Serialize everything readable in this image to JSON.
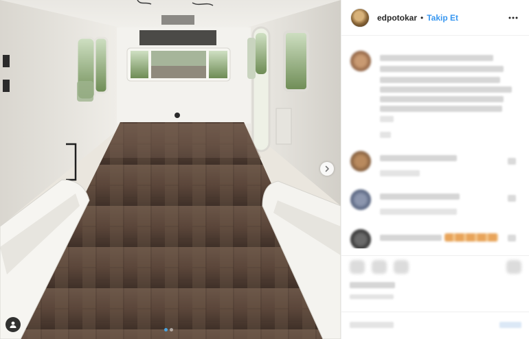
{
  "post": {
    "username": "edpotokar",
    "separator": "•",
    "follow_label": "Takip Et",
    "carousel": {
      "total_slides": 2,
      "active_slide": 1
    }
  },
  "icons": {
    "next": "chevron-right-icon",
    "user_tag": "user-tag-icon",
    "more": "more-options-icon"
  },
  "colors": {
    "follow_blue": "#3897f0",
    "carousel_dot_active": "#4aa3df"
  }
}
